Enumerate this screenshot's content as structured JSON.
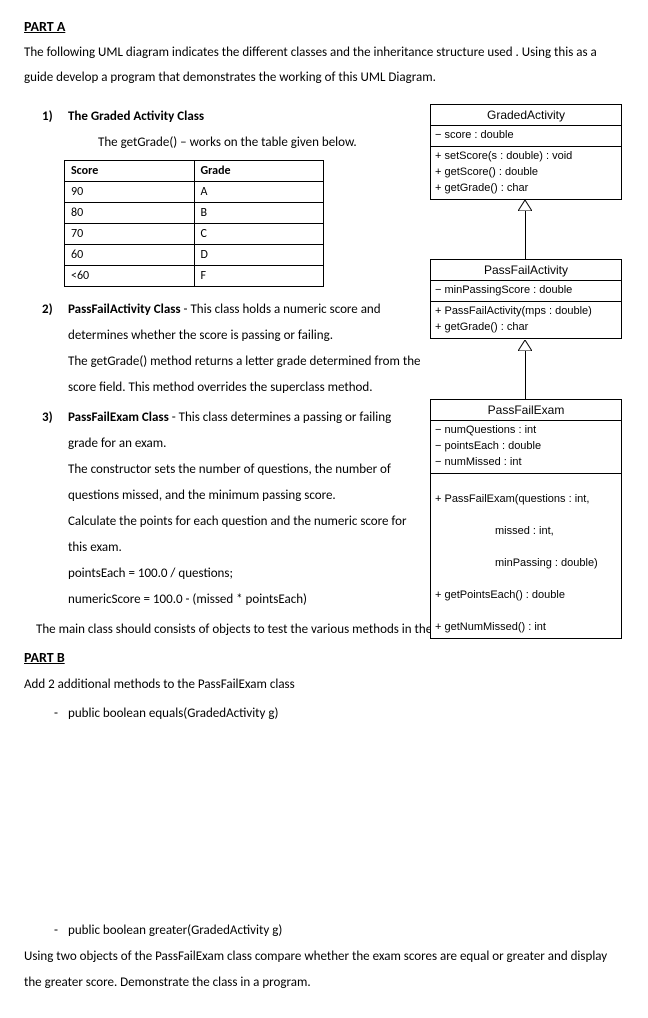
{
  "headings": {
    "part_a": "PART A",
    "part_b": "PART B"
  },
  "intro": "The following UML diagram indicates the different classes and the inheritance structure used . Using this as a guide develop a program that demonstrates the working of this UML Diagram.",
  "item1": {
    "title": "The Graded Activity Class",
    "line1": "The getGrade() – works on the table given below."
  },
  "score_table": {
    "headers": [
      "Score",
      "Grade"
    ],
    "rows": [
      [
        "90",
        "A"
      ],
      [
        "80",
        "B"
      ],
      [
        "70",
        "C"
      ],
      [
        "60",
        "D"
      ],
      [
        "<60",
        "F"
      ]
    ]
  },
  "item2": {
    "title": "PassFailActivity Class",
    "rest": " - This class holds a numeric score and determines whether the score is passing or failing.",
    "p2": "The getGrade() method returns a letter grade determined from the score field. This method overrides the superclass method."
  },
  "item3": {
    "title": "PassFailExam Class",
    "rest": " - This class determines a passing or failing grade for an exam.",
    "p2": "The constructor sets the number of questions, the number of questions missed, and the minimum passing score.",
    "p3": "Calculate the points for each question and the numeric score for this exam.",
    "p4": "pointsEach = 100.0 / questions;",
    "p5": "numericScore = 100.0 - (missed * pointsEach)"
  },
  "main_note": "The main class should consists of objects to test the various methods in the classes given.",
  "part_b_intro": "Add 2 additional methods to the PassFailExam class",
  "part_b_m1": "public boolean equals(GradedActivity g)",
  "part_b_m2": "public boolean greater(GradedActivity g)",
  "part_b_p2": "Using two objects of the PassFailExam class compare whether the exam scores are equal or greater and display the greater score. Demonstrate the class in a program.",
  "uml": {
    "c1": {
      "name": "GradedActivity",
      "attrs": "− score : double",
      "ops": "+ setScore(s : double) : void\n+ getScore() : double\n+ getGrade() : char"
    },
    "c2": {
      "name": "PassFailActivity",
      "attrs": "− minPassingScore : double",
      "ops": "+ PassFailActivity(mps : double)\n+ getGrade() : char"
    },
    "c3": {
      "name": "PassFailExam",
      "attrs": "− numQuestions : int\n− pointsEach : double\n− numMissed : int",
      "ops_l1": "+ PassFailExam(questions : int,",
      "ops_l2": "missed : int,",
      "ops_l3": "minPassing : double)",
      "ops_l4": "+ getPointsEach() : double",
      "ops_l5": "+ getNumMissed() : int"
    }
  }
}
